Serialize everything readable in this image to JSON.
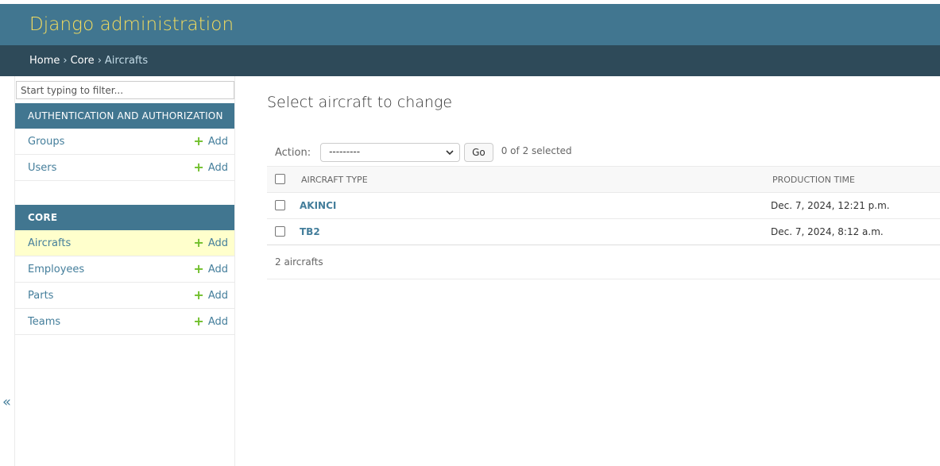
{
  "header": {
    "branding": "Django administration"
  },
  "breadcrumbs": {
    "home": "Home",
    "app": "Core",
    "current": "Aircrafts",
    "separator": "›"
  },
  "sidebar": {
    "filter_placeholder": "Start typing to filter...",
    "toggle_label": "«",
    "modules": [
      {
        "caption": "AUTHENTICATION AND AUTHORIZATION",
        "models": [
          {
            "name": "Groups",
            "add": "Add"
          },
          {
            "name": "Users",
            "add": "Add"
          }
        ]
      },
      {
        "caption": "CORE",
        "models": [
          {
            "name": "Aircrafts",
            "add": "Add",
            "current": true
          },
          {
            "name": "Employees",
            "add": "Add"
          },
          {
            "name": "Parts",
            "add": "Add"
          },
          {
            "name": "Teams",
            "add": "Add"
          }
        ]
      }
    ]
  },
  "content": {
    "title": "Select aircraft to change",
    "actions": {
      "label": "Action:",
      "selected_option": "---------",
      "go": "Go",
      "selection_count": "0 of 2 selected"
    },
    "table": {
      "columns": [
        "AIRCRAFT TYPE",
        "PRODUCTION TIME"
      ],
      "rows": [
        {
          "aircraft_type": "AKINCI",
          "production_time": "Dec. 7, 2024, 12:21 p.m."
        },
        {
          "aircraft_type": "TB2",
          "production_time": "Dec. 7, 2024, 8:12 a.m."
        }
      ]
    },
    "paginator": "2 aircrafts"
  },
  "colors": {
    "header_bg": "#417690",
    "branding": "#f5dd5d",
    "breadcrumbs_bg": "#2e4a59",
    "link": "#447e9b",
    "add_plus": "#70bf2b",
    "current_row": "#ffffcc"
  },
  "icons": {
    "add": "plus-icon",
    "select": "chevron-down-icon",
    "toggle": "double-chevron-left-icon"
  }
}
